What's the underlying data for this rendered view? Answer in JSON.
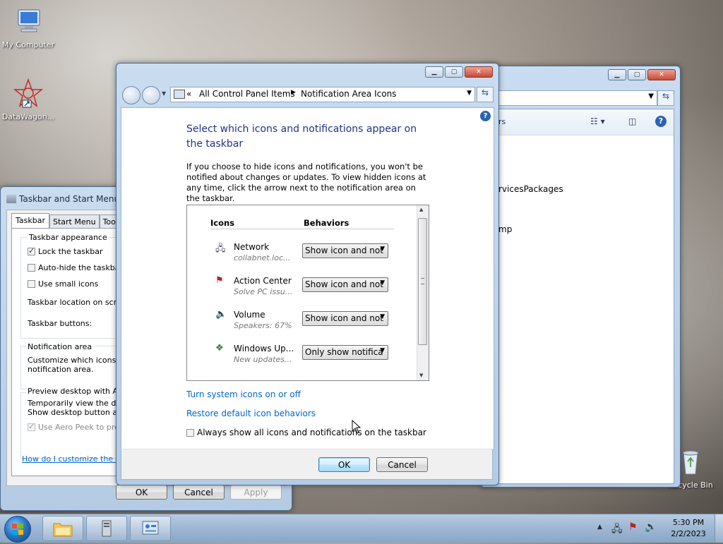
{
  "desktop": {
    "icons": [
      {
        "label": "My Computer"
      },
      {
        "label": "DataWagon..."
      },
      {
        "label": "Recycle Bin"
      }
    ]
  },
  "taskbar_props": {
    "title": "Taskbar and Start Menu P",
    "tabs": [
      "Taskbar",
      "Start Menu",
      "Toolb"
    ],
    "group_appearance": "Taskbar appearance",
    "lock": "Lock the taskbar",
    "autohide": "Auto-hide the taskbar",
    "small_icons": "Use small icons",
    "location": "Taskbar location on screen",
    "buttons": "Taskbar buttons:",
    "group_notification": "Notification area",
    "notification_text1": "Customize which icons and",
    "notification_text2": "notification area.",
    "preview_heading": "Preview desktop with Aero",
    "preview_text1": "Temporarily view the desk",
    "preview_text2": "Show desktop button at e",
    "aero_peek": "Use Aero Peek to previ",
    "help_link": "How do I customize the task",
    "ok": "OK",
    "cancel": "Cancel",
    "apply": "Apply"
  },
  "background_window": {
    "text1": "rs",
    "text2": "rvicesPackages",
    "text3": "mp"
  },
  "notification_window": {
    "breadcrumb_prefix": "«",
    "breadcrumb": [
      "All Control Panel Items",
      "Notification Area Icons"
    ],
    "heading": "Select which icons and notifications appear on the taskbar",
    "description": "If you choose to hide icons and notifications, you won't be notified about changes or updates. To view hidden icons at any time, click the arrow next to the notification area on the taskbar.",
    "col_icons": "Icons",
    "col_behaviors": "Behaviors",
    "rows": [
      {
        "name": "Network",
        "sub": "collabnet.loc...",
        "behavior": "Show icon and not"
      },
      {
        "name": "Action Center",
        "sub": "Solve PC issu...",
        "behavior": "Show icon and not"
      },
      {
        "name": "Volume",
        "sub": "Speakers: 67%",
        "behavior": "Show icon and not"
      },
      {
        "name": "Windows Up...",
        "sub": "New updates...",
        "behavior": "Only show notifica"
      }
    ],
    "link_system_icons": "Turn system icons on or off",
    "link_restore": "Restore default icon behaviors",
    "always_show": "Always show all icons and notifications on the taskbar",
    "ok": "OK",
    "cancel": "Cancel"
  },
  "tray": {
    "time": "5:30 PM",
    "date": "2/2/2023"
  }
}
